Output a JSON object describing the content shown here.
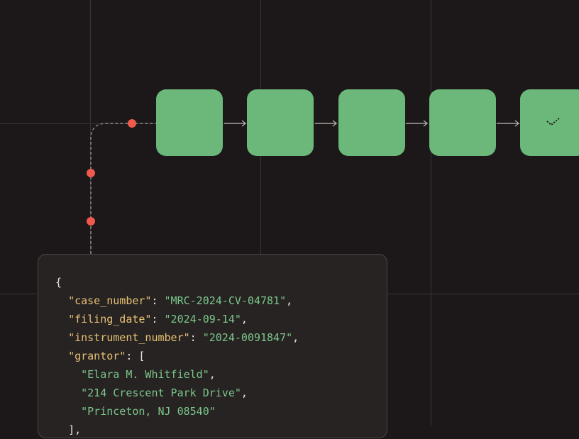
{
  "colors": {
    "background": "#1c1819",
    "grid": "#3a3637",
    "node": "#6bb87a",
    "connector_dot": "#f0594c",
    "panel_bg": "#262322",
    "json_key": "#e8c074",
    "json_string": "#7cc68b"
  },
  "pipeline": {
    "node_count": 5,
    "final_node_icon": "check-icon"
  },
  "json_panel": {
    "open_brace": "{",
    "entries": [
      {
        "key": "\"case_number\"",
        "value": "\"MRC-2024-CV-04781\""
      },
      {
        "key": "\"filing_date\"",
        "value": "\"2024-09-14\""
      },
      {
        "key": "\"instrument_number\"",
        "value": "\"2024-0091847\""
      }
    ],
    "grantor_key": "\"grantor\"",
    "grantor_open": "[",
    "grantor_items": [
      "\"Elara M. Whitfield\"",
      "\"214 Crescent Park Drive\"",
      "\"Princeton, NJ 08540\""
    ],
    "grantor_close": "],"
  }
}
